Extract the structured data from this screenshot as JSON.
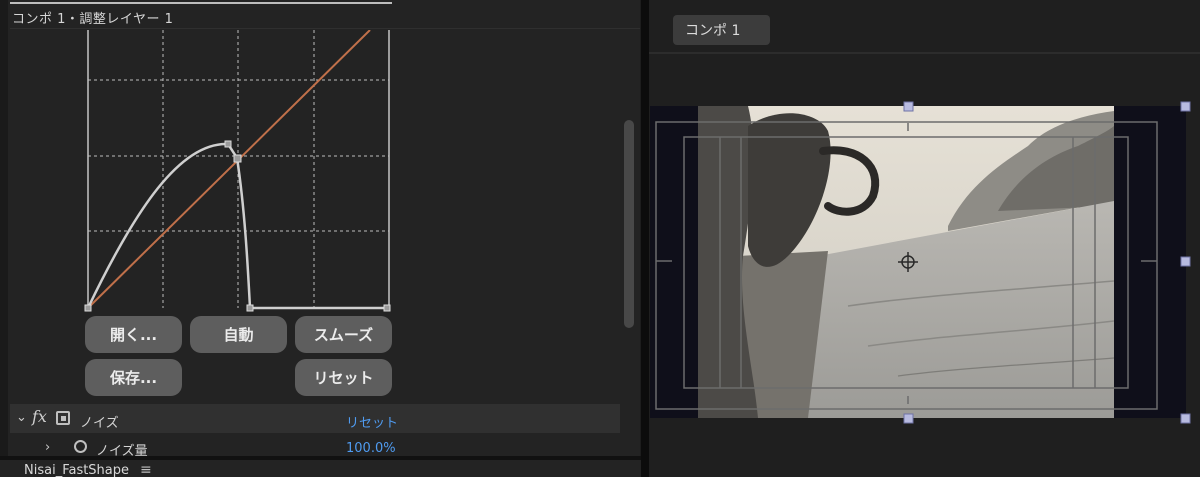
{
  "left_panel": {
    "title": "コンポ 1・調整レイヤー 1",
    "buttons": {
      "open": "開く...",
      "auto": "自動",
      "smooth": "スムーズ",
      "save": "保存...",
      "reset": "リセット"
    }
  },
  "effects": {
    "noise": {
      "name": "ノイズ",
      "reset_label": "リセット",
      "fx_label": "fx",
      "properties": [
        {
          "name": "ノイズ量",
          "value": "100.0%"
        }
      ]
    }
  },
  "bottom_panel": {
    "tab_label": "Nisai_FastShape",
    "menu_icon": "hamburger-icon"
  },
  "right_panel": {
    "tab_label": "コンポ 1"
  },
  "colors": {
    "diagonal_curve": "#c0704a",
    "white_curve": "#cfcfcf",
    "link_blue": "#4f9bf0",
    "button_bg": "#5e5e5e"
  }
}
